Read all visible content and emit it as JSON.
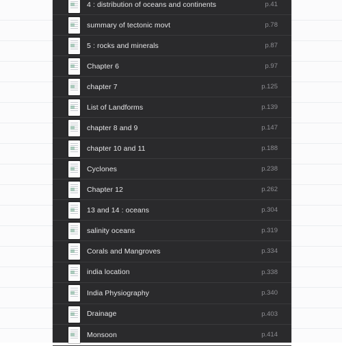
{
  "toc": {
    "items": [
      {
        "title": "4 : distribution of oceans and continents",
        "page": "p.41"
      },
      {
        "title": "summary of tectonic movt",
        "page": "p.78"
      },
      {
        "title": "5 : rocks and minerals",
        "page": "p.87"
      },
      {
        "title": "Chapter 6",
        "page": "p.97"
      },
      {
        "title": "chapter 7",
        "page": "p.125"
      },
      {
        "title": "List of Landforms",
        "page": "p.139"
      },
      {
        "title": "chapter 8 and 9",
        "page": "p.147"
      },
      {
        "title": "chapter 10 and 11",
        "page": "p.188"
      },
      {
        "title": "Cyclones",
        "page": "p.238"
      },
      {
        "title": "Chapter 12",
        "page": "p.262"
      },
      {
        "title": "13 and 14 : oceans",
        "page": "p.304"
      },
      {
        "title": "salinity oceans",
        "page": "p.319"
      },
      {
        "title": "Corals and Mangroves",
        "page": "p.334"
      },
      {
        "title": "india location",
        "page": "p.338"
      },
      {
        "title": "India Physiography",
        "page": "p.340"
      },
      {
        "title": "Drainage",
        "page": "p.403"
      },
      {
        "title": "Monsoon",
        "page": "p.414"
      }
    ]
  },
  "icons": {
    "thumbnail": "page-thumbnail-icon"
  },
  "colors": {
    "panel_bg": "#2a2a2c",
    "title_text": "#e6e6e8",
    "page_text": "#8e8e93",
    "separator": "#3a3a3c"
  }
}
